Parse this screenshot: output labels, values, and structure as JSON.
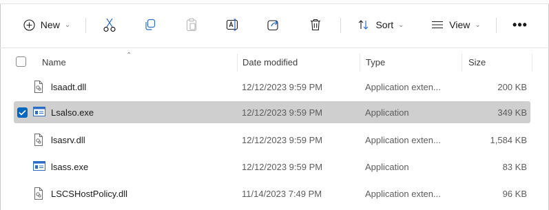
{
  "toolbar": {
    "new_label": "New",
    "sort_label": "Sort",
    "view_label": "View",
    "more_label": "•••",
    "icons": [
      "plus-circle-icon",
      "cut-icon",
      "copy-icon",
      "paste-icon",
      "rename-icon",
      "share-icon",
      "delete-icon",
      "sort-icon",
      "view-icon",
      "more-icon"
    ]
  },
  "columns": {
    "name": "Name",
    "date": "Date modified",
    "type": "Type",
    "size": "Size"
  },
  "files": [
    {
      "name": "lsaadt.dll",
      "date": "12/12/2023 9:59 PM",
      "type": "Application exten...",
      "size": "200 KB",
      "icon": "dll-file-icon",
      "selected": false
    },
    {
      "name": "Lsalso.exe",
      "date": "12/12/2023 9:59 PM",
      "type": "Application",
      "size": "349 KB",
      "icon": "exe-file-icon",
      "selected": true
    },
    {
      "name": "lsasrv.dll",
      "date": "12/12/2023 9:59 PM",
      "type": "Application exten...",
      "size": "1,584 KB",
      "icon": "dll-file-icon",
      "selected": false
    },
    {
      "name": "lsass.exe",
      "date": "12/12/2023 9:59 PM",
      "type": "Application",
      "size": "83 KB",
      "icon": "exe-file-icon",
      "selected": false
    },
    {
      "name": "LSCSHostPolicy.dll",
      "date": "11/14/2023 7:49 PM",
      "type": "Application exten...",
      "size": "96 KB",
      "icon": "dll-file-icon",
      "selected": false
    }
  ],
  "colors": {
    "selection_bg": "#cfcfcf",
    "check_accent": "#0067c0",
    "exe_icon_blue": "#2b6cc4"
  }
}
